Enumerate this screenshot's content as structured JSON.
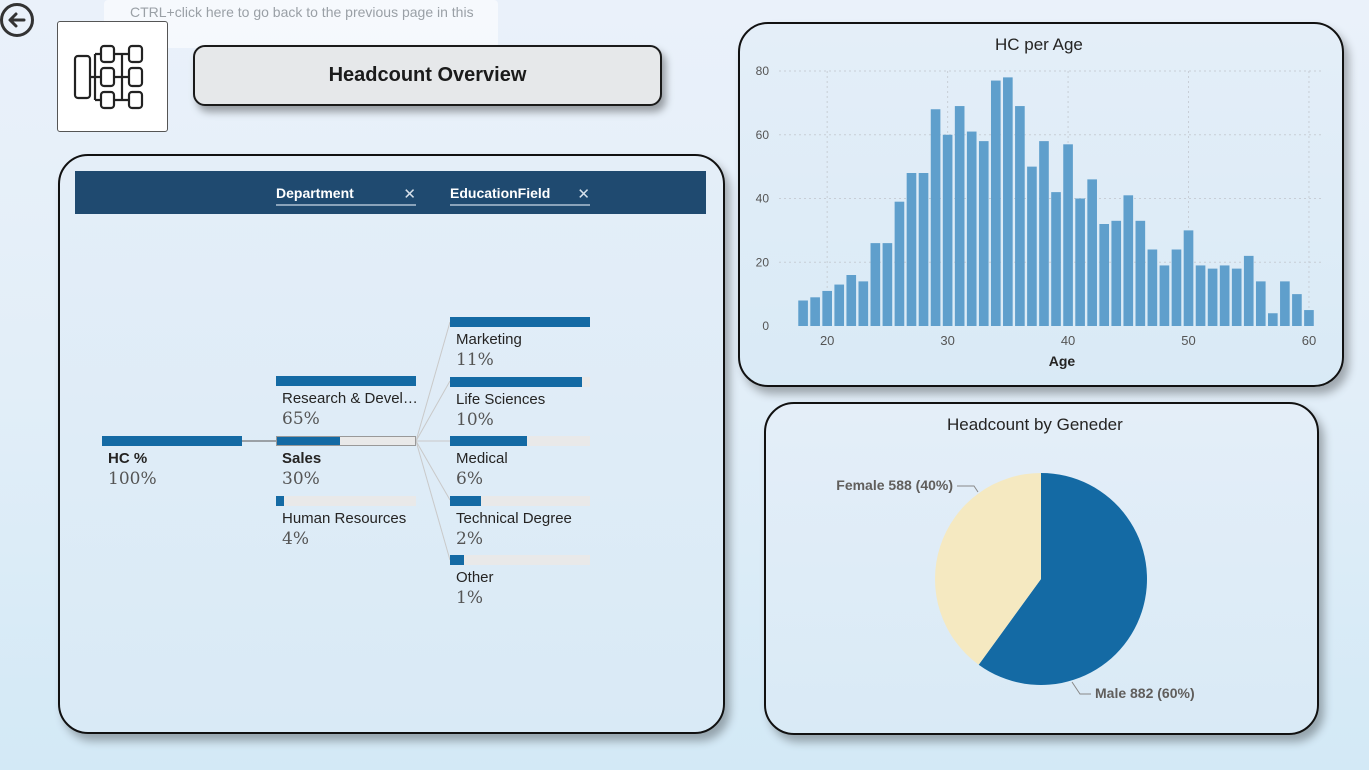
{
  "nav": {
    "tooltip": "CTRL+click here to go back to the previous page in this report"
  },
  "header": {
    "title": "Headcount Overview"
  },
  "decomposition": {
    "fields": [
      "Department",
      "EducationField"
    ],
    "root": {
      "label": "HC %",
      "value": "100%"
    },
    "departments": [
      {
        "label": "Research & Devel…",
        "value": "65%",
        "fraction": 1.0
      },
      {
        "label": "Sales",
        "value": "30%",
        "fraction": 0.46
      },
      {
        "label": "Human Resources",
        "value": "4%",
        "fraction": 0.06
      }
    ],
    "education": [
      {
        "label": "Marketing",
        "value": "11%",
        "fraction": 1.0
      },
      {
        "label": "Life Sciences",
        "value": "10%",
        "fraction": 0.94
      },
      {
        "label": "Medical",
        "value": "6%",
        "fraction": 0.55
      },
      {
        "label": "Technical Degree",
        "value": "2%",
        "fraction": 0.22
      },
      {
        "label": "Other",
        "value": "1%",
        "fraction": 0.1
      }
    ]
  },
  "chart_data": [
    {
      "type": "bar",
      "title": "HC per Age",
      "xlabel": "Age",
      "ylabel": "",
      "x": [
        18,
        19,
        20,
        21,
        22,
        23,
        24,
        25,
        26,
        27,
        28,
        29,
        30,
        31,
        32,
        33,
        34,
        35,
        36,
        37,
        38,
        39,
        40,
        41,
        42,
        43,
        44,
        45,
        46,
        47,
        48,
        49,
        50,
        51,
        52,
        53,
        54,
        55,
        56,
        57,
        58,
        59,
        60
      ],
      "values": [
        8,
        9,
        11,
        13,
        16,
        14,
        26,
        26,
        39,
        48,
        48,
        68,
        60,
        69,
        61,
        58,
        77,
        78,
        69,
        50,
        58,
        42,
        57,
        40,
        46,
        32,
        33,
        41,
        33,
        24,
        19,
        24,
        30,
        19,
        18,
        19,
        18,
        22,
        14,
        4,
        14,
        10,
        5
      ],
      "ylim": [
        0,
        80
      ],
      "xlim": [
        16,
        61
      ],
      "xticks": [
        20,
        30,
        40,
        50,
        60
      ],
      "yticks": [
        0,
        20,
        40,
        60,
        80
      ],
      "grid": true,
      "color": "#5f9fcc"
    },
    {
      "type": "pie",
      "title": "Headcount by Geneder",
      "slices": [
        {
          "name": "Male",
          "value": 882,
          "label": "Male 882 (60%)",
          "color": "#146aa4"
        },
        {
          "name": "Female",
          "value": 588,
          "label": "Female 588 (40%)",
          "color": "#f5e9c1"
        }
      ]
    }
  ]
}
